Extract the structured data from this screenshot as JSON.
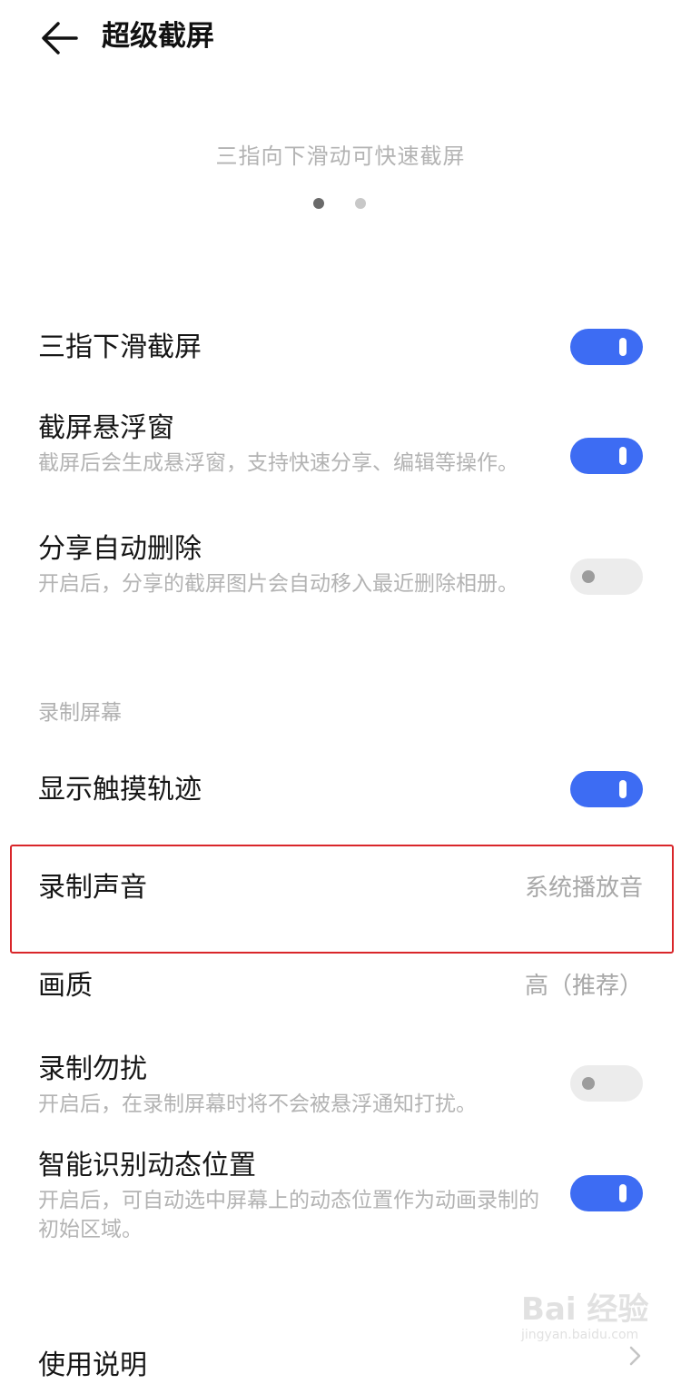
{
  "header": {
    "back_icon": "arrow-left-icon",
    "title": "超级截屏"
  },
  "carousel": {
    "hint": "三指向下滑动可快速截屏",
    "page_count": 2,
    "active_index": 0
  },
  "settings": {
    "three_finger": {
      "title": "三指下滑截屏",
      "enabled": true
    },
    "floating_window": {
      "title": "截屏悬浮窗",
      "subtitle": "截屏后会生成悬浮窗，支持快速分享、编辑等操作。",
      "enabled": true
    },
    "auto_delete": {
      "title": "分享自动删除",
      "subtitle": "开启后，分享的截屏图片会自动移入最近删除相册。",
      "enabled": false
    }
  },
  "recording": {
    "section_label": "录制屏幕",
    "touch_trail": {
      "title": "显示触摸轨迹",
      "enabled": true
    },
    "record_sound": {
      "title": "录制声音",
      "value": "系统播放音"
    },
    "quality": {
      "title": "画质",
      "value": "高（推荐）"
    },
    "dnd": {
      "title": "录制勿扰",
      "subtitle": "开启后，在录制屏幕时将不会被悬浮通知打扰。",
      "enabled": false
    },
    "smart_region": {
      "title": "智能识别动态位置",
      "subtitle": "开启后，可自动选中屏幕上的动态位置作为动画录制的初始区域。",
      "enabled": true
    }
  },
  "footer": {
    "instructions": "使用说明"
  },
  "colors": {
    "accent": "#3d6cf3",
    "highlight": "#d9262a"
  },
  "watermark": {
    "logo": "Bai 经验",
    "url": "jingyan.baidu.com"
  }
}
